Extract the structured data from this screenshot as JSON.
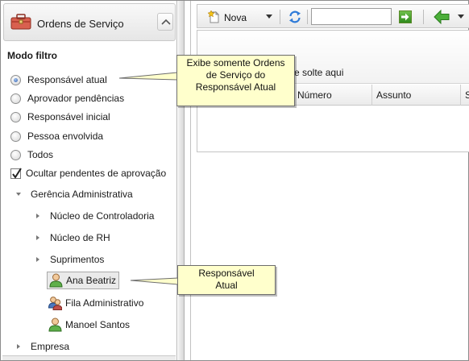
{
  "panel": {
    "title": "Ordens de Serviço",
    "filter_title": "Modo filtro",
    "options": [
      {
        "label": "Responsável atual",
        "checked": true
      },
      {
        "label": "Aprovador pendências",
        "checked": false
      },
      {
        "label": "Responsável inicial",
        "checked": false
      },
      {
        "label": "Pessoa envolvida",
        "checked": false
      },
      {
        "label": "Todos",
        "checked": false
      }
    ],
    "hide_pending_label": "Ocultar pendentes de aprovação",
    "hide_pending_checked": true
  },
  "tree": {
    "root": "Gerência Administrativa",
    "children": [
      "Núcleo de Controladoria",
      "Núcleo de RH",
      "Suprimentos"
    ],
    "leaves": [
      "Ana Beatriz",
      "Fila Administrativo",
      "Manoel Santos"
    ],
    "other": "Empresa"
  },
  "toolbar": {
    "new_label": "Nova",
    "search_value": ""
  },
  "grid": {
    "group_hint": "e solte aqui",
    "columns": [
      "Número",
      "Assunto",
      "S"
    ]
  },
  "callouts": {
    "current_owner": [
      "Exibe somente Ordens",
      "de Serviço do",
      "Responsável Atual"
    ],
    "owner_label": [
      "Responsável",
      "Atual"
    ]
  },
  "icons": {
    "app": "toolbox-icon",
    "collapse": "chevron-up-icon",
    "new": "new-document-icon",
    "refresh": "refresh-icon",
    "go": "go-arrow-icon",
    "back": "back-arrow-icon",
    "person": "person-icon",
    "group": "group-icon"
  },
  "colors": {
    "callout_bg": "#ffffcc",
    "selection_bg": "#eaeaea",
    "go_green": "#2f8a1c"
  }
}
